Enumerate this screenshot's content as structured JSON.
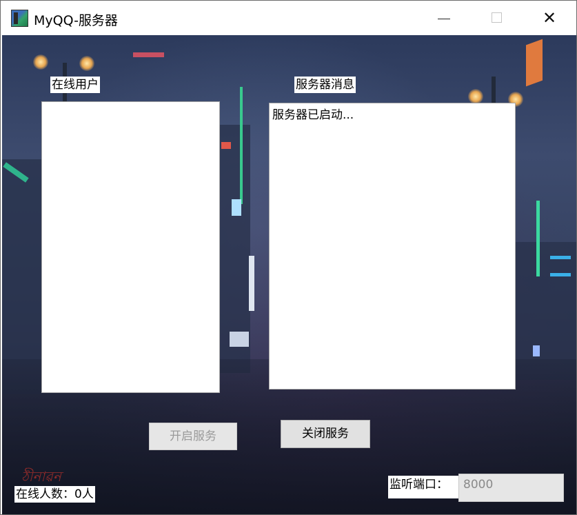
{
  "window": {
    "title": "MyQQ-服务器",
    "controls": {
      "minimize": "—",
      "maximize": "",
      "close": "✕"
    }
  },
  "panels": {
    "online_users_label": "在线用户",
    "server_messages_label": "服务器消息",
    "online_users": [],
    "server_messages": [
      "服务器已启动..."
    ]
  },
  "buttons": {
    "start_label": "开启服务",
    "start_enabled": false,
    "stop_label": "关闭服务",
    "stop_enabled": true
  },
  "status": {
    "online_count_text": "在线人数：0人",
    "listen_port_label": "监听端口：",
    "listen_port_value": "8000"
  },
  "icons": {
    "app": "app-icon",
    "minimize": "minimize-icon",
    "maximize": "maximize-icon",
    "close": "close-icon"
  }
}
